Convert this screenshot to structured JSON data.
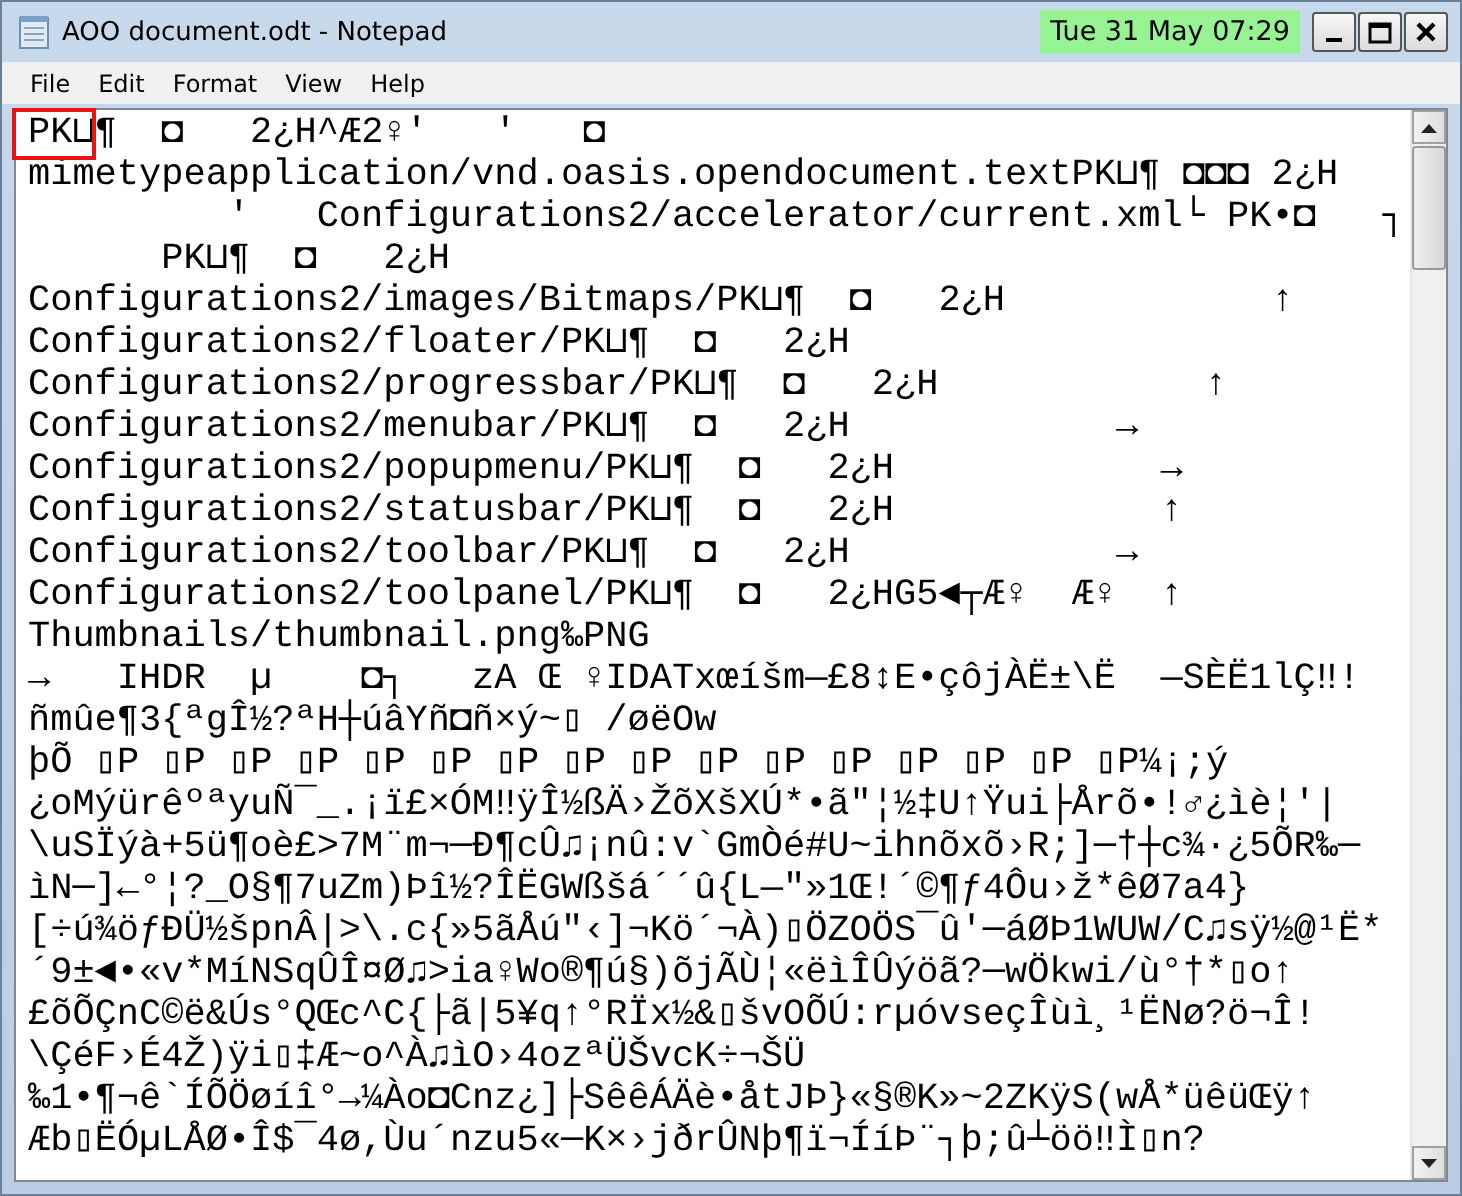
{
  "window": {
    "title": "AOO document.odt - Notepad",
    "clock": "Tue 31  May 07:29"
  },
  "menu": [
    "File",
    "Edit",
    "Format",
    "View",
    "Help"
  ],
  "document": {
    "highlight_first_token": true,
    "lines": [
      "PK⊔¶  ◘   2¿H^Æ2♀'   '   ◘",
      "mimetypeapplication/vnd.oasis.opendocument.textPK⊔¶ ◘◘◘ 2¿H",
      "         '   Configurations2/accelerator/current.xml└ PK•◘   ┐",
      "      PK⊔¶  ◘   2¿H",
      "Configurations2/images/Bitmaps/PK⊔¶  ◘   2¿H            ↑",
      "Configurations2/floater/PK⊔¶  ◘   2¿H",
      "Configurations2/progressbar/PK⊔¶  ◘   2¿H            ↑",
      "Configurations2/menubar/PK⊔¶  ◘   2¿H            →",
      "Configurations2/popupmenu/PK⊔¶  ◘   2¿H            →",
      "Configurations2/statusbar/PK⊔¶  ◘   2¿H            ↑",
      "Configurations2/toolbar/PK⊔¶  ◘   2¿H            →",
      "Configurations2/toolpanel/PK⊔¶  ◘   2¿HG5◄┬Æ♀  Æ♀  ↑",
      "Thumbnails/thumbnail.png‰PNG",
      "→   IHDR  µ    ◘┐   zA Œ ♀IDATxœíšm—£8↕E•çôjÀË±\\Ë  —SÈË1lÇ‼!",
      "ñmûe¶3{ªgÎ½?ªH┼úâYñ◘ñ×ý~▯ /øëOw",
      "þÕ ▯P ▯P ▯P ▯P ▯P ▯P ▯P ▯P ▯P ▯P ▯P ▯P ▯P ▯P ▯P ▯P¼¡;ý",
      "¿oMýürêºªyuÑ¯_.¡ï£×ÓM‼ÿÎ½ßÄ›ŽõXšXÚ*•ã\"¦½‡U↑Ÿui├Årõ•!♂¿ìè¦'|",
      "\\uSÏýà+5ü¶oè£>7M¨m¬─Ð¶cÛ♫¡nû:v`GmÒé#U~ihnõxõ›R;]─†┼c¾·¿5ÕR‰─",
      "ìN─]←°¦?_O§¶7uZm)Þî½?ÎËGWßšá´´û{L—\"»1Œ!´©¶ƒ4Ôu›ž*êØ7a4}",
      "[÷ú¾öƒÐÜ½špnÂ|>\\.c{»5ãÅú\"‹]¬Kö´¬À)▯ÖZOÖS¯û'─áØÞ1WUW/C♫sÿ½@¹Ë*",
      "´9±◄•«v*MíNSqÛÎ¤Ø♫>ia♀Wo®¶ú§)õjÃÙ¦«ëìÎÛýöã?─wÖkwi/ù°†*▯o↑",
      "£õÕÇnC©ë&Ús°QŒc^C{├ã|5¥q↑°RÏx½&▯švOÕÚ:rµóvseçÎùì¸¹ËNø?ö¬Î!",
      "\\ÇéF›É4Ž)ÿi▯‡Æ~o^À♫ìO›4ozªÜŠvcK÷¬ŠÜ",
      "‰1•¶¬ê`ÍÕÖøíî°→¼Ào◘Cnz¿]├SêêÁÄè•åtJÞ}«§®K»~2ZKÿS(wÅ*üêüŒÿ↑",
      "Æb▯ËÓµLÅØ•Î$¯4ø,Ùu´nzu5«─K×›jðrÛNþ¶ï¬ÍíÞ¨┐þ;û┴öö‼Ì▯n?"
    ]
  }
}
